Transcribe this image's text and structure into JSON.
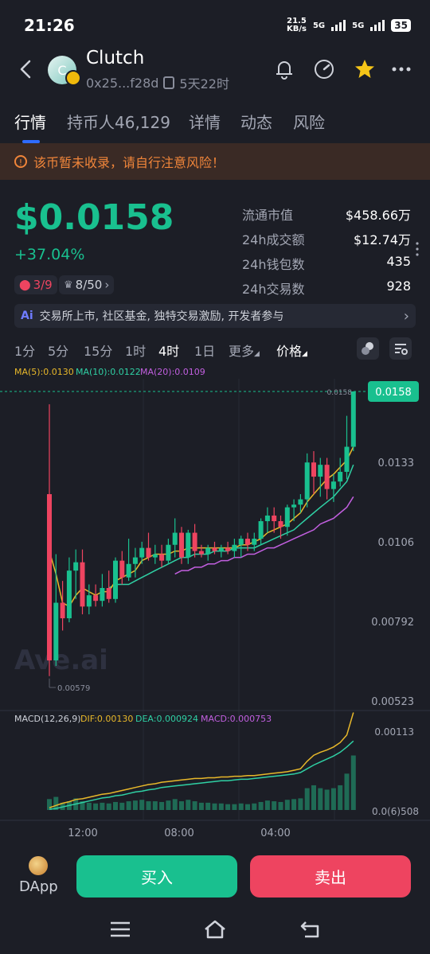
{
  "status_bar": {
    "time": "21:26",
    "net_speed": "21.5",
    "net_unit": "KB/s",
    "sig1": "5G",
    "sig2": "5G",
    "battery": "35"
  },
  "header": {
    "title": "Clutch",
    "avatar_letter": "C",
    "address": "0x25...f28d",
    "age": "5天22时"
  },
  "tabs": [
    {
      "label": "行情"
    },
    {
      "label": "持币人46,129"
    },
    {
      "label": "详情"
    },
    {
      "label": "动态"
    },
    {
      "label": "风险"
    }
  ],
  "warning": {
    "icon": "!",
    "text": "该币暂未收录，请自行注意风险！"
  },
  "price": {
    "value": "$0.0158",
    "change": "+37.04%",
    "risk_badge": "3/9",
    "rank_badge": "8/50"
  },
  "stats": [
    {
      "label": "流通市值",
      "value": "$458.66万"
    },
    {
      "label": "24h成交额",
      "value": "$12.74万"
    },
    {
      "label": "24h钱包数",
      "value": "435"
    },
    {
      "label": "24h交易数",
      "value": "928"
    }
  ],
  "ai_bar": {
    "badge": "Ai",
    "text": "交易所上市, 社区基金, 独特交易激励, 开发者参与"
  },
  "timeframes": [
    {
      "label": "1分"
    },
    {
      "label": "5分"
    },
    {
      "label": "15分"
    },
    {
      "label": "1时"
    },
    {
      "label": "4时"
    },
    {
      "label": "1日"
    },
    {
      "label": "更多"
    },
    {
      "label": "价格"
    }
  ],
  "ma_legend": {
    "ma5": "MA(5):0.0130",
    "ma10": "MA(10):0.0122",
    "ma20": "MA(20):0.0109"
  },
  "chart": {
    "current_price_tag": "0.0158",
    "current_price_small": "0.0158",
    "low_marker": "0.00579",
    "watermark": "Ave.ai",
    "y_ticks": [
      "0.0133",
      "0.0106",
      "0.00792",
      "0.00523"
    ],
    "macd_legend": {
      "label": "MACD(12,26,9)",
      "dif": "DIF:0.00130",
      "dea": "DEA:0.000924",
      "macd": "MACD:0.000753"
    },
    "macd_ticks": [
      "0.00113",
      "0.0(6)508"
    ],
    "x_ticks": [
      "12:00",
      "08:00",
      "04:00"
    ],
    "colors": {
      "up": "#19c08f",
      "down": "#ee4460",
      "ma5": "#e8b82a",
      "ma10": "#2fd0a4",
      "ma20": "#c25fe0"
    }
  },
  "chart_data": {
    "type": "candlestick",
    "title": "",
    "ylabel": "",
    "xlabel": "",
    "ylim": [
      0.00523,
      0.0158
    ],
    "y_scale": "log",
    "x_ticks": [
      "12:00",
      "08:00",
      "04:00"
    ],
    "series": [
      {
        "name": "MA(5)"
      },
      {
        "name": "MA(10)"
      },
      {
        "name": "MA(20)"
      }
    ],
    "candles": [
      {
        "o": 0.011,
        "h": 0.0151,
        "l": 0.00579,
        "c": 0.00612
      },
      {
        "o": 0.00612,
        "h": 0.0089,
        "l": 0.006,
        "c": 0.0075
      },
      {
        "o": 0.0075,
        "h": 0.0081,
        "l": 0.0068,
        "c": 0.0071
      },
      {
        "o": 0.0071,
        "h": 0.0088,
        "l": 0.007,
        "c": 0.0084
      },
      {
        "o": 0.0084,
        "h": 0.00905,
        "l": 0.0076,
        "c": 0.00865
      },
      {
        "o": 0.00865,
        "h": 0.00905,
        "l": 0.0072,
        "c": 0.0074
      },
      {
        "o": 0.0074,
        "h": 0.008,
        "l": 0.0072,
        "c": 0.0077
      },
      {
        "o": 0.0077,
        "h": 0.008,
        "l": 0.0074,
        "c": 0.00755
      },
      {
        "o": 0.00755,
        "h": 0.0083,
        "l": 0.0074,
        "c": 0.0079
      },
      {
        "o": 0.0079,
        "h": 0.0084,
        "l": 0.0075,
        "c": 0.0076
      },
      {
        "o": 0.0076,
        "h": 0.0088,
        "l": 0.0075,
        "c": 0.0087
      },
      {
        "o": 0.0087,
        "h": 0.009,
        "l": 0.008,
        "c": 0.0082
      },
      {
        "o": 0.0082,
        "h": 0.0094,
        "l": 0.0081,
        "c": 0.0086
      },
      {
        "o": 0.0086,
        "h": 0.0091,
        "l": 0.0082,
        "c": 0.0088
      },
      {
        "o": 0.0088,
        "h": 0.0093,
        "l": 0.0086,
        "c": 0.0091
      },
      {
        "o": 0.0091,
        "h": 0.0096,
        "l": 0.0087,
        "c": 0.0088
      },
      {
        "o": 0.0088,
        "h": 0.0092,
        "l": 0.0086,
        "c": 0.0089
      },
      {
        "o": 0.0089,
        "h": 0.0092,
        "l": 0.0085,
        "c": 0.0087
      },
      {
        "o": 0.0087,
        "h": 0.0094,
        "l": 0.0086,
        "c": 0.0092
      },
      {
        "o": 0.0092,
        "h": 0.0101,
        "l": 0.0088,
        "c": 0.0096
      },
      {
        "o": 0.0096,
        "h": 0.0098,
        "l": 0.0086,
        "c": 0.0088
      },
      {
        "o": 0.0088,
        "h": 0.0097,
        "l": 0.0086,
        "c": 0.0096
      },
      {
        "o": 0.0096,
        "h": 0.0099,
        "l": 0.0088,
        "c": 0.009
      },
      {
        "o": 0.009,
        "h": 0.0092,
        "l": 0.0088,
        "c": 0.0089
      },
      {
        "o": 0.0089,
        "h": 0.0092,
        "l": 0.0087,
        "c": 0.0091
      },
      {
        "o": 0.0091,
        "h": 0.0093,
        "l": 0.0089,
        "c": 0.009
      },
      {
        "o": 0.009,
        "h": 0.0092,
        "l": 0.0088,
        "c": 0.0091
      },
      {
        "o": 0.0091,
        "h": 0.0093,
        "l": 0.0089,
        "c": 0.009
      },
      {
        "o": 0.009,
        "h": 0.0094,
        "l": 0.0088,
        "c": 0.0092
      },
      {
        "o": 0.0092,
        "h": 0.0095,
        "l": 0.0088,
        "c": 0.0094
      },
      {
        "o": 0.0094,
        "h": 0.0096,
        "l": 0.009,
        "c": 0.0092
      },
      {
        "o": 0.0092,
        "h": 0.0096,
        "l": 0.009,
        "c": 0.0094
      },
      {
        "o": 0.0094,
        "h": 0.0101,
        "l": 0.0092,
        "c": 0.01
      },
      {
        "o": 0.01,
        "h": 0.0105,
        "l": 0.0096,
        "c": 0.0102
      },
      {
        "o": 0.0102,
        "h": 0.0105,
        "l": 0.0096,
        "c": 0.01
      },
      {
        "o": 0.01,
        "h": 0.0102,
        "l": 0.0094,
        "c": 0.0098
      },
      {
        "o": 0.0098,
        "h": 0.0106,
        "l": 0.0095,
        "c": 0.0105
      },
      {
        "o": 0.0105,
        "h": 0.0108,
        "l": 0.01,
        "c": 0.0106
      },
      {
        "o": 0.0106,
        "h": 0.011,
        "l": 0.0103,
        "c": 0.0108
      },
      {
        "o": 0.0108,
        "h": 0.0127,
        "l": 0.0105,
        "c": 0.0123
      },
      {
        "o": 0.0123,
        "h": 0.0128,
        "l": 0.011,
        "c": 0.0117
      },
      {
        "o": 0.0117,
        "h": 0.0125,
        "l": 0.0109,
        "c": 0.0122
      },
      {
        "o": 0.0122,
        "h": 0.0125,
        "l": 0.0108,
        "c": 0.0112
      },
      {
        "o": 0.0112,
        "h": 0.0118,
        "l": 0.0107,
        "c": 0.0115
      },
      {
        "o": 0.0115,
        "h": 0.0125,
        "l": 0.0113,
        "c": 0.0119
      },
      {
        "o": 0.0119,
        "h": 0.0145,
        "l": 0.0116,
        "c": 0.013
      },
      {
        "o": 0.013,
        "h": 0.0158,
        "l": 0.0128,
        "c": 0.0158
      }
    ],
    "ma5": [
      0.009,
      0.0083,
      0.0075,
      0.0074,
      0.0077,
      0.0079,
      0.0078,
      0.0077,
      0.0078,
      0.0078,
      0.0081,
      0.0082,
      0.0083,
      0.0084,
      0.0087,
      0.0088,
      0.0089,
      0.0089,
      0.0089,
      0.009,
      0.009,
      0.0091,
      0.0091,
      0.0091,
      0.0091,
      0.0091,
      0.0091,
      0.0091,
      0.0091,
      0.0092,
      0.0092,
      0.0093,
      0.0094,
      0.0096,
      0.0097,
      0.0098,
      0.0099,
      0.0101,
      0.0103,
      0.0107,
      0.011,
      0.0113,
      0.0116,
      0.0118,
      0.0121,
      0.0124,
      0.013
    ],
    "ma10": [
      null,
      null,
      null,
      null,
      null,
      null,
      null,
      null,
      null,
      0.0079,
      0.008,
      0.008,
      0.008,
      0.0081,
      0.0082,
      0.0083,
      0.0084,
      0.0085,
      0.0086,
      0.0087,
      0.0088,
      0.0088,
      0.0089,
      0.0089,
      0.0089,
      0.009,
      0.009,
      0.009,
      0.0091,
      0.0091,
      0.0091,
      0.0091,
      0.0092,
      0.0093,
      0.0094,
      0.0095,
      0.0096,
      0.0097,
      0.0099,
      0.0101,
      0.0103,
      0.0105,
      0.0107,
      0.0109,
      0.0112,
      0.0115,
      0.0122
    ],
    "ma20": [
      null,
      null,
      null,
      null,
      null,
      null,
      null,
      null,
      null,
      null,
      null,
      null,
      null,
      null,
      null,
      null,
      null,
      null,
      null,
      0.0083,
      0.0084,
      0.0084,
      0.0085,
      0.0085,
      0.0086,
      0.0086,
      0.0087,
      0.0087,
      0.0088,
      0.0088,
      0.0089,
      0.0089,
      0.009,
      0.0091,
      0.0091,
      0.0092,
      0.0093,
      0.0094,
      0.0095,
      0.0096,
      0.0097,
      0.0099,
      0.01,
      0.0101,
      0.0103,
      0.0105,
      0.0109
    ],
    "macd_hist": [
      0.00015,
      0.00018,
      0.0001,
      0.00012,
      0.00016,
      0.00012,
      0.0001,
      9e-05,
      0.0001,
      9e-05,
      0.00011,
      0.0001,
      0.00012,
      0.00013,
      0.00014,
      0.00012,
      0.00012,
      0.00011,
      0.00013,
      0.00015,
      0.00012,
      0.00014,
      0.00012,
      0.0001,
      0.0001,
      9e-05,
      9e-05,
      8e-05,
      8e-05,
      9e-05,
      8e-05,
      9e-05,
      0.00011,
      0.00013,
      0.00012,
      0.00011,
      0.00014,
      0.00015,
      0.00016,
      0.0003,
      0.00034,
      0.0003,
      0.00028,
      0.0003,
      0.00034,
      0.0005,
      0.00075
    ],
    "dif": [
      3e-05,
      6e-05,
      9e-05,
      0.00011,
      0.00014,
      0.00015,
      0.00017,
      0.00019,
      0.00021,
      0.00022,
      0.00024,
      0.00026,
      0.00028,
      0.0003,
      0.00032,
      0.00034,
      0.00035,
      0.00037,
      0.00038,
      0.00039,
      0.0004,
      0.00041,
      0.00042,
      0.00042,
      0.00043,
      0.00043,
      0.00044,
      0.00044,
      0.00045,
      0.00045,
      0.00046,
      0.00046,
      0.00047,
      0.00048,
      0.00049,
      0.0005,
      0.00051,
      0.00053,
      0.00055,
      0.00065,
      0.00073,
      0.00077,
      0.0008,
      0.00084,
      0.0009,
      0.001,
      0.0013
    ],
    "dea": [
      1e-05,
      2e-05,
      4e-05,
      6e-05,
      8e-05,
      0.0001,
      0.00012,
      0.00014,
      0.00016,
      0.00017,
      0.00019,
      0.0002,
      0.00022,
      0.00024,
      0.00025,
      0.00027,
      0.00028,
      0.0003,
      0.00031,
      0.00032,
      0.00033,
      0.00034,
      0.00035,
      0.00036,
      0.00037,
      0.00038,
      0.00039,
      0.00039,
      0.0004,
      0.00041,
      0.00041,
      0.00042,
      0.00043,
      0.00044,
      0.00045,
      0.00046,
      0.00047,
      0.00048,
      0.0005,
      0.00055,
      0.0006,
      0.00064,
      0.00068,
      0.00072,
      0.00077,
      0.00084,
      0.00092
    ]
  },
  "actions": {
    "dapp": "DApp",
    "buy": "买入",
    "sell": "卖出"
  }
}
